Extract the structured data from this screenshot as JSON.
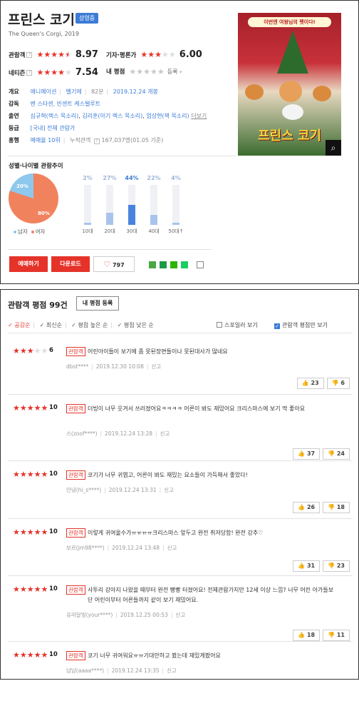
{
  "movie": {
    "title": "프린스 코기",
    "status": "상영중",
    "original": "The Queen's Corgi, 2019",
    "audience_label": "관람객",
    "audience_score": "8.97",
    "audience_stars": 4.5,
    "critic_label": "기자·평론가",
    "critic_score": "6.00",
    "critic_stars": 3,
    "netizen_label": "네티즌",
    "netizen_score": "7.54",
    "netizen_stars": 4,
    "my_label": "내 평점",
    "my_register": "등록",
    "info": {
      "overview_k": "개요",
      "genre1": "애니메이션",
      "genre2": "벨기에",
      "runtime": "82분",
      "release": "2019.12.24 개봉",
      "director_k": "감독",
      "director": "벤 스타센, 빈센트 케스텔루트",
      "cast_k": "출연",
      "cast1": "심규혁(렉스 목소리)",
      "cast2": "김리훈(아기 렉스 목소리)",
      "cast3": "엄상현(잭 목소리)",
      "more": "더보기",
      "rating_k": "등급",
      "rating": "[국내] 전체 관람가",
      "boxoffice_k": "흥행",
      "rank": "예매율 10위",
      "audience_total": "누적관객",
      "audience_count": "167,037명(01.05 기준)"
    }
  },
  "poster": {
    "banner": "이번엔 여왕님의 펫이다!",
    "title": "프린스 코기",
    "search_icon": "search-icon"
  },
  "demographics": {
    "title": "성별·나이별 관람추이",
    "male_pct": "20%",
    "female_pct": "80%",
    "male_label": "남자",
    "female_label": "여자",
    "male_value": 20,
    "female_value": 80,
    "ages": [
      {
        "label": "10대",
        "pct": "2%",
        "value": 2
      },
      {
        "label": "20대",
        "pct": "27%",
        "value": 27
      },
      {
        "label": "30대",
        "pct": "44%",
        "value": 44
      },
      {
        "label": "40대",
        "pct": "22%",
        "value": 22
      },
      {
        "label": "50대↑",
        "pct": "4%",
        "value": 4
      }
    ],
    "highlight_index": 2
  },
  "actions": {
    "reserve": "예매하기",
    "download": "다운로드",
    "likes": "797"
  },
  "reviews_header": {
    "title": "관람객 평점",
    "count": "99건",
    "write_button": "내 평점 등록",
    "sort": [
      "공감순",
      "최신순",
      "평점 높은 순",
      "평점 낮은 순"
    ],
    "spoiler": "스포일러 보기",
    "audience_only": "관람객 평점만 보기"
  },
  "reviews": [
    {
      "stars": 3,
      "score": "6",
      "tag": "관람객",
      "text": "어린아이들이 보기에 좀 못된장면들이나 못된대사가 많네요",
      "user": "dbst****",
      "date": "2019.12.30 10:08",
      "report": "신고",
      "up": "23",
      "down": "6"
    },
    {
      "stars": 5,
      "score": "10",
      "tag": "관람객",
      "text": "더빙이 너무 웃겨서 쓰러졌어요ㅋㅋㅋㅋ 어른이 봐도 재밌어요 크리스마스에 보기 딱 좋아요",
      "user": "스(zoof****)",
      "date": "2019.12.24 13:28",
      "report": "신고",
      "up": "37",
      "down": "24"
    },
    {
      "stars": 5,
      "score": "10",
      "tag": "관람객",
      "text": "코기가 너무 귀엽고, 어른이 봐도 재밌는 요소들이 가득해서 좋았다!",
      "user": "안녕(hi_s****)",
      "date": "2019.12.24 13:31",
      "report": "신고",
      "up": "26",
      "down": "18"
    },
    {
      "stars": 5,
      "score": "10",
      "tag": "관람객",
      "text": "이렇게 귀여울수가ㅠㅠㅠㅠ크리스마스 앞두고 완전 취저당함! 완전 강추♡",
      "user": "보르(jm98****)",
      "date": "2019.12.24 13:48",
      "report": "신고",
      "up": "31",
      "down": "23"
    },
    {
      "stars": 5,
      "score": "10",
      "tag": "관람객",
      "text": "사투리 강아지 나왔을 때부터 완전 빵빵 터졌어요! 전체관람가지만 12세 이상 느낌? 너무 어린 아가들보단 어린이부터 어른들까지 같이 보기 재밌어요.",
      "user": "유리달빛(your****)",
      "date": "2019.12.25 00:53",
      "report": "신고",
      "up": "18",
      "down": "11"
    },
    {
      "stars": 5,
      "score": "10",
      "tag": "관람객",
      "text": "코기 너무 귀여워요ㅠㅠ기대안하고 봤는데 재밌게봤어요",
      "user": "냠냠(aaaa****)",
      "date": "2019.12.24 13:35",
      "report": "신고",
      "up": "",
      "down": ""
    }
  ],
  "colors": {
    "accent_red": "#e5332a",
    "accent_blue": "#3d7cd6"
  }
}
